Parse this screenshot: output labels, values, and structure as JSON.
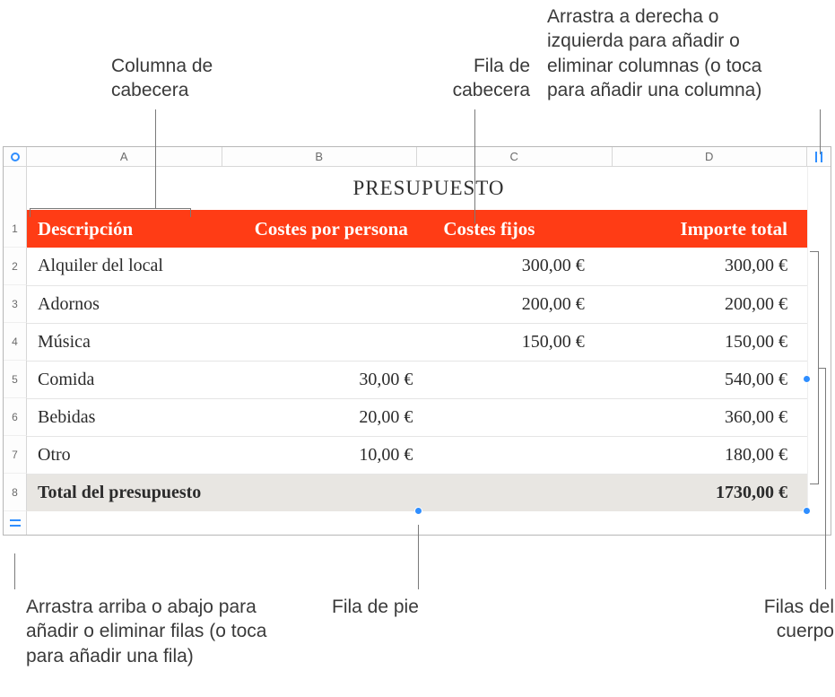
{
  "callouts": {
    "header_column": "Columna de\ncabecera",
    "header_row": "Fila de\ncabecera",
    "add_columns": "Arrastra a derecha o\nizquierda para añadir o\neliminar columnas (o toca\npara añadir una columna)",
    "add_rows": "Arrastra arriba o abajo para\nañadir o eliminar filas (o toca\npara añadir una fila)",
    "footer_row": "Fila de pie",
    "body_rows": "Filas del\ncuerpo"
  },
  "columns": [
    "A",
    "B",
    "C",
    "D"
  ],
  "row_numbers": [
    "1",
    "2",
    "3",
    "4",
    "5",
    "6",
    "7",
    "8"
  ],
  "table": {
    "title": "PRESUPUESTO",
    "headers": {
      "desc": "Descripción",
      "per_person": "Costes por persona",
      "fixed": "Costes fijos",
      "total": "Importe total"
    },
    "rows": [
      {
        "desc": "Alquiler del local",
        "per_person": "",
        "fixed": "300,00 €",
        "total": "300,00 €"
      },
      {
        "desc": "Adornos",
        "per_person": "",
        "fixed": "200,00 €",
        "total": "200,00 €"
      },
      {
        "desc": "Música",
        "per_person": "",
        "fixed": "150,00 €",
        "total": "150,00 €"
      },
      {
        "desc": "Comida",
        "per_person": "30,00 €",
        "fixed": "",
        "total": "540,00 €"
      },
      {
        "desc": "Bebidas",
        "per_person": "20,00 €",
        "fixed": "",
        "total": "360,00 €"
      },
      {
        "desc": "Otro",
        "per_person": "10,00 €",
        "fixed": "",
        "total": "180,00 €"
      }
    ],
    "footer": {
      "label": "Total del presupuesto",
      "total": "1730,00 €"
    }
  }
}
